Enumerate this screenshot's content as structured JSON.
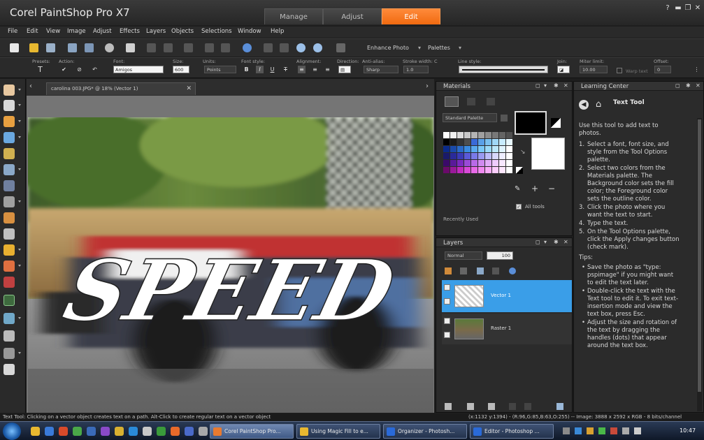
{
  "app": {
    "title": "Corel PaintShop Pro X7"
  },
  "workspace_tabs": [
    {
      "label": "Manage",
      "active": false
    },
    {
      "label": "Adjust",
      "active": false
    },
    {
      "label": "Edit",
      "active": true
    }
  ],
  "colors": {
    "accent": "#f07014",
    "selection": "#3a9ee8",
    "panel_bg": "#2b2b2b"
  },
  "menu": [
    "File",
    "Edit",
    "View",
    "Image",
    "Adjust",
    "Effects",
    "Layers",
    "Objects",
    "Selections",
    "Window",
    "Help"
  ],
  "toolbar": {
    "enhance_photo": "Enhance Photo",
    "palettes": "Palettes"
  },
  "tool_options": {
    "presets_label": "Presets:",
    "action_label": "Action:",
    "font_label": "Font:",
    "font_value": "Amigos",
    "size_label": "Size:",
    "size_value": "600",
    "units_label": "Units:",
    "units_value": "Points",
    "font_style_label": "Font style:",
    "bold": "B",
    "italic": "I",
    "underline": "U",
    "strike": "T",
    "alignment_label": "Alignment:",
    "direction_label": "Direction:",
    "antialias_label": "Anti-alias:",
    "antialias_value": "Sharp",
    "stroke_label": "Stroke width: C",
    "stroke_value": "1.0",
    "line_style_label": "Line style:",
    "join_label": "Join:",
    "miter_label": "Miter limit:",
    "miter_value": "10.00",
    "warp_label": "Warp text",
    "offset_label": "Offset:",
    "offset_value": "0"
  },
  "document": {
    "tab_label": "carolina 003.JPG* @ 18% (Vector 1)",
    "overlay_text": "SPEED"
  },
  "materials": {
    "title": "Materials",
    "palette_select": "Standard Palette",
    "all_tools": "All tools",
    "recently_used": "Recently Used"
  },
  "layers": {
    "title": "Layers",
    "blend_mode": "Normal",
    "opacity": "100",
    "items": [
      {
        "name": "Vector 1",
        "selected": true
      },
      {
        "name": "Raster 1",
        "selected": false
      }
    ]
  },
  "learning_center": {
    "title": "Learning Center",
    "heading": "Text Tool",
    "intro_lines": [
      "Use this tool to add text to",
      "photos."
    ],
    "steps": [
      {
        "num": "1.",
        "lines": [
          "Select a font, font size, and",
          "style from the Tool Options",
          "palette."
        ]
      },
      {
        "num": "2.",
        "lines": [
          "Select two colors from the",
          "Materials palette. The",
          "Background color sets the fill",
          "color; the Foreground color",
          "sets the outline color."
        ]
      },
      {
        "num": "3.",
        "lines": [
          "Click the photo where you",
          "want the text to start."
        ]
      },
      {
        "num": "4.",
        "lines": [
          "Type the text."
        ]
      },
      {
        "num": "5.",
        "lines": [
          "On the Tool Options palette,",
          "click the Apply changes button",
          "(check mark)."
        ]
      }
    ],
    "tips_label": "Tips:",
    "tips": [
      {
        "lines": [
          "Save the photo as \"type:",
          "pspimage\" if you might want",
          "to edit the text later."
        ]
      },
      {
        "lines": [
          "Double-click the text with the",
          "Text tool to edit it. To exit text-",
          "insertion mode and view the",
          "text box, press Esc."
        ]
      },
      {
        "lines": [
          "Adjust the size and rotation of",
          "the text by dragging the",
          "handles (dots) that appear",
          "around the text box."
        ]
      }
    ]
  },
  "status": {
    "left": "Text Tool: Clicking on a vector object creates text on a path. Alt-Click to create regular text on a vector object",
    "right": "(x:1132 y:1394) - (R:96,G:85,B:63,O:255) -- Image: 3888 x 2592 x RGB - 8 bits/channel"
  },
  "taskbar": {
    "items": [
      {
        "label": "Corel PaintShop Pro...",
        "active": true
      },
      {
        "label": "Using Magic Fill to e...",
        "active": false
      },
      {
        "label": "Organizer - Photosh...",
        "active": false
      },
      {
        "label": "Editor - Photoshop ...",
        "active": false
      }
    ],
    "clock": "10:47"
  }
}
